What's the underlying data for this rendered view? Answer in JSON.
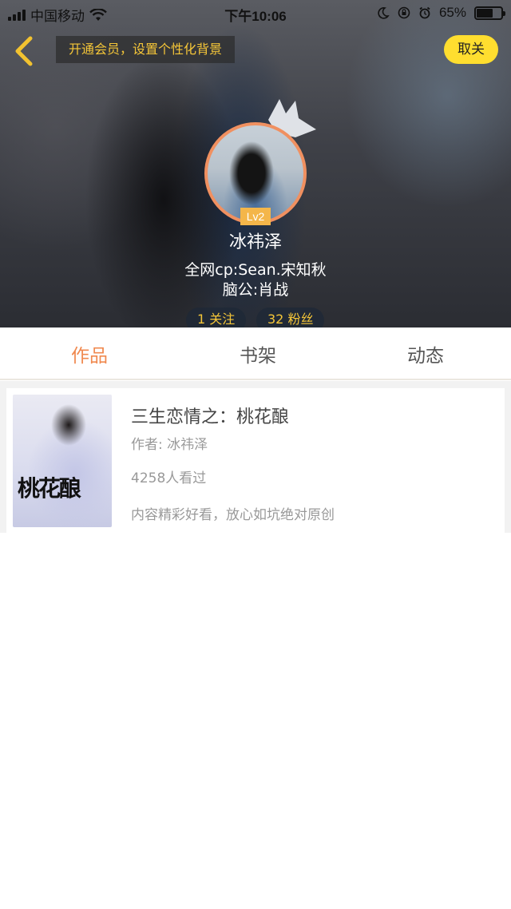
{
  "status_bar": {
    "carrier": "中国移动",
    "time": "下午10:06",
    "battery_percent": "65%",
    "battery_level": 0.65
  },
  "top_bar": {
    "vip_banner": "开通会员，设置个性化背景",
    "follow_button": "取关"
  },
  "profile": {
    "level": "Lv2",
    "username": "冰祎泽",
    "bio_line1": "全网cp:Sean.宋知秋",
    "bio_line2": "脑公:肖战",
    "following": "1 关注",
    "fans": "32 粉丝"
  },
  "tabs": [
    {
      "label": "作品",
      "active": true
    },
    {
      "label": "书架",
      "active": false
    },
    {
      "label": "动态",
      "active": false
    }
  ],
  "books": [
    {
      "cover_text": "桃花酿",
      "title": "三生恋情之：桃花酿",
      "author": "作者: 冰祎泽",
      "views": "4258人看过",
      "description": "内容精彩好看，放心如坑绝对原创"
    }
  ],
  "colors": {
    "accent": "#f0894f",
    "follow_button": "#ffde2f",
    "vip_text": "#f5c638",
    "level_badge": "#f4b64a"
  },
  "icons": [
    "signal-icon",
    "wifi-icon",
    "moon-icon",
    "orientation-lock-icon",
    "alarm-icon",
    "battery-icon",
    "back-chevron-icon",
    "crown-icon"
  ]
}
